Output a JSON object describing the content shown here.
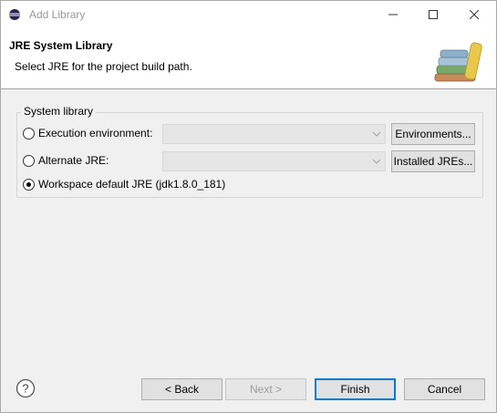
{
  "window": {
    "title": "Add Library",
    "controls": {
      "minimize": "minimize-icon",
      "maximize": "maximize-icon",
      "close": "close-icon"
    }
  },
  "banner": {
    "title": "JRE System Library",
    "description": "Select JRE for the project build path.",
    "icon": "library-books-icon"
  },
  "group": {
    "label": "System library",
    "options": [
      {
        "label": "Execution environment:",
        "selected": false,
        "combo_value": "",
        "button_label": "Environments..."
      },
      {
        "label": "Alternate JRE:",
        "selected": false,
        "combo_value": "",
        "button_label": "Installed JREs..."
      },
      {
        "label": "Workspace default JRE (jdk1.8.0_181)",
        "selected": true
      }
    ]
  },
  "footer": {
    "help_icon": "help-icon",
    "back_label": "< Back",
    "next_label": "Next >",
    "finish_label": "Finish",
    "cancel_label": "Cancel"
  },
  "colors": {
    "accent": "#0078d7",
    "disabled_text": "#9c9c9c"
  }
}
